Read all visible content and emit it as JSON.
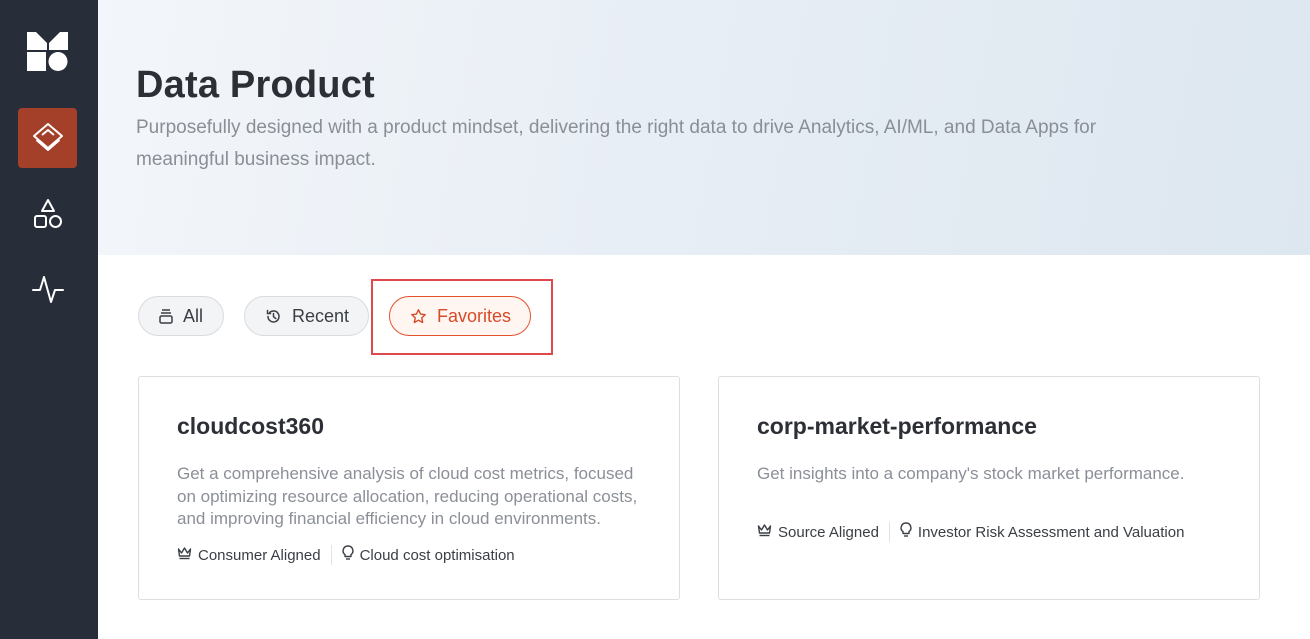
{
  "sidebar": {
    "logo": "brand-logo",
    "items": [
      {
        "icon": "layers-icon",
        "active": true
      },
      {
        "icon": "shapes-icon",
        "active": false
      },
      {
        "icon": "activity-icon",
        "active": false
      }
    ]
  },
  "header": {
    "title": "Data Product",
    "subtitle": "Purposefully designed with a product mindset, delivering the right data to drive Analytics, AI/ML, and Data Apps for meaningful business impact."
  },
  "filters": [
    {
      "label": "All",
      "icon": "stack-icon",
      "active": false
    },
    {
      "label": "Recent",
      "icon": "history-icon",
      "active": false
    },
    {
      "label": "Favorites",
      "icon": "star-icon",
      "active": true
    }
  ],
  "products": [
    {
      "name": "cloudcost360",
      "description": "Get a comprehensive analysis of cloud cost metrics, focused on optimizing resource allocation, reducing operational costs, and improving financial efficiency in cloud environments.",
      "alignment": "Consumer Aligned",
      "use_case": "Cloud cost optimisation"
    },
    {
      "name": "corp-market-performance",
      "description": "Get insights into a company's stock market performance.",
      "alignment": "Source Aligned",
      "use_case": "Investor Risk Assessment and Valuation"
    }
  ],
  "colors": {
    "sidebar_bg": "#282e39",
    "active_accent": "#a4402a",
    "favorite_accent": "#d84a28",
    "highlight_box": "#e0494b"
  }
}
